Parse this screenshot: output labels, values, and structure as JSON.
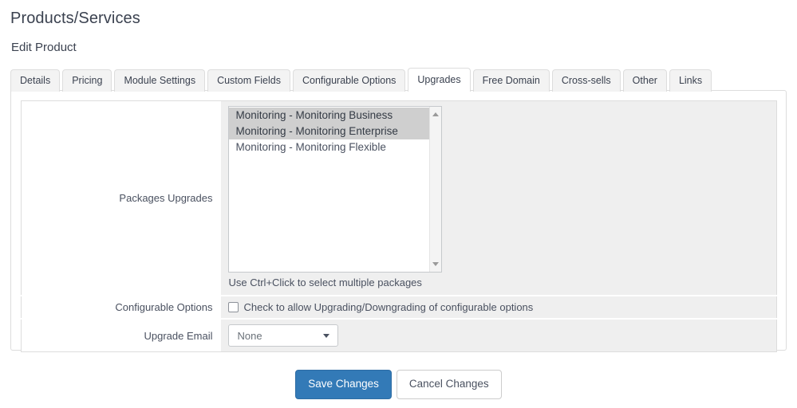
{
  "header": {
    "page_title": "Products/Services",
    "sub_title": "Edit Product"
  },
  "tabs": [
    {
      "label": "Details",
      "active": false
    },
    {
      "label": "Pricing",
      "active": false
    },
    {
      "label": "Module Settings",
      "active": false
    },
    {
      "label": "Custom Fields",
      "active": false
    },
    {
      "label": "Configurable Options",
      "active": false
    },
    {
      "label": "Upgrades",
      "active": true
    },
    {
      "label": "Free Domain",
      "active": false
    },
    {
      "label": "Cross-sells",
      "active": false
    },
    {
      "label": "Other",
      "active": false
    },
    {
      "label": "Links",
      "active": false
    }
  ],
  "form": {
    "packages_upgrades": {
      "label": "Packages Upgrades",
      "help_text": "Use Ctrl+Click to select multiple packages",
      "options": [
        {
          "label": "Monitoring - Monitoring Business",
          "selected": true
        },
        {
          "label": "Monitoring - Monitoring Enterprise",
          "selected": true
        },
        {
          "label": "Monitoring - Monitoring Flexible",
          "selected": false
        }
      ]
    },
    "configurable_options": {
      "label": "Configurable Options",
      "checkbox_label": "Check to allow Upgrading/Downgrading of configurable options",
      "checked": false
    },
    "upgrade_email": {
      "label": "Upgrade Email",
      "value": "None",
      "options": [
        "None"
      ]
    }
  },
  "actions": {
    "save_label": "Save Changes",
    "cancel_label": "Cancel Changes"
  },
  "colors": {
    "primary": "#337ab7",
    "primary_border": "#2e6da4",
    "text": "#4a5160",
    "heading": "#3b4250",
    "row_bg": "#efefef",
    "selection_bg": "#cfcfcf",
    "border": "#dddddd"
  },
  "icons": {
    "scroll_up": "scroll-up-arrow-icon",
    "scroll_down": "scroll-down-arrow-icon",
    "select_chevron": "chevron-down-icon"
  }
}
